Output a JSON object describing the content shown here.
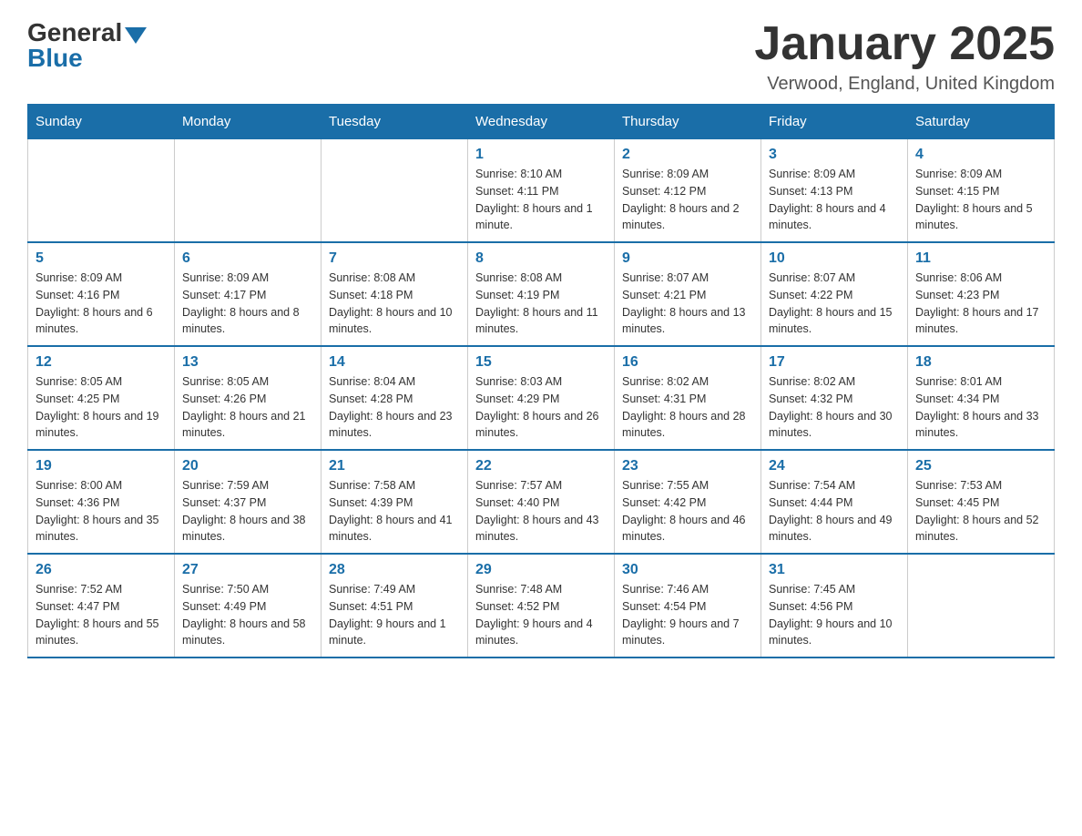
{
  "header": {
    "logo_general": "General",
    "logo_blue": "Blue",
    "title": "January 2025",
    "location": "Verwood, England, United Kingdom"
  },
  "days_of_week": [
    "Sunday",
    "Monday",
    "Tuesday",
    "Wednesday",
    "Thursday",
    "Friday",
    "Saturday"
  ],
  "weeks": [
    [
      {
        "day": "",
        "info": ""
      },
      {
        "day": "",
        "info": ""
      },
      {
        "day": "",
        "info": ""
      },
      {
        "day": "1",
        "info": "Sunrise: 8:10 AM\nSunset: 4:11 PM\nDaylight: 8 hours and 1 minute."
      },
      {
        "day": "2",
        "info": "Sunrise: 8:09 AM\nSunset: 4:12 PM\nDaylight: 8 hours and 2 minutes."
      },
      {
        "day": "3",
        "info": "Sunrise: 8:09 AM\nSunset: 4:13 PM\nDaylight: 8 hours and 4 minutes."
      },
      {
        "day": "4",
        "info": "Sunrise: 8:09 AM\nSunset: 4:15 PM\nDaylight: 8 hours and 5 minutes."
      }
    ],
    [
      {
        "day": "5",
        "info": "Sunrise: 8:09 AM\nSunset: 4:16 PM\nDaylight: 8 hours and 6 minutes."
      },
      {
        "day": "6",
        "info": "Sunrise: 8:09 AM\nSunset: 4:17 PM\nDaylight: 8 hours and 8 minutes."
      },
      {
        "day": "7",
        "info": "Sunrise: 8:08 AM\nSunset: 4:18 PM\nDaylight: 8 hours and 10 minutes."
      },
      {
        "day": "8",
        "info": "Sunrise: 8:08 AM\nSunset: 4:19 PM\nDaylight: 8 hours and 11 minutes."
      },
      {
        "day": "9",
        "info": "Sunrise: 8:07 AM\nSunset: 4:21 PM\nDaylight: 8 hours and 13 minutes."
      },
      {
        "day": "10",
        "info": "Sunrise: 8:07 AM\nSunset: 4:22 PM\nDaylight: 8 hours and 15 minutes."
      },
      {
        "day": "11",
        "info": "Sunrise: 8:06 AM\nSunset: 4:23 PM\nDaylight: 8 hours and 17 minutes."
      }
    ],
    [
      {
        "day": "12",
        "info": "Sunrise: 8:05 AM\nSunset: 4:25 PM\nDaylight: 8 hours and 19 minutes."
      },
      {
        "day": "13",
        "info": "Sunrise: 8:05 AM\nSunset: 4:26 PM\nDaylight: 8 hours and 21 minutes."
      },
      {
        "day": "14",
        "info": "Sunrise: 8:04 AM\nSunset: 4:28 PM\nDaylight: 8 hours and 23 minutes."
      },
      {
        "day": "15",
        "info": "Sunrise: 8:03 AM\nSunset: 4:29 PM\nDaylight: 8 hours and 26 minutes."
      },
      {
        "day": "16",
        "info": "Sunrise: 8:02 AM\nSunset: 4:31 PM\nDaylight: 8 hours and 28 minutes."
      },
      {
        "day": "17",
        "info": "Sunrise: 8:02 AM\nSunset: 4:32 PM\nDaylight: 8 hours and 30 minutes."
      },
      {
        "day": "18",
        "info": "Sunrise: 8:01 AM\nSunset: 4:34 PM\nDaylight: 8 hours and 33 minutes."
      }
    ],
    [
      {
        "day": "19",
        "info": "Sunrise: 8:00 AM\nSunset: 4:36 PM\nDaylight: 8 hours and 35 minutes."
      },
      {
        "day": "20",
        "info": "Sunrise: 7:59 AM\nSunset: 4:37 PM\nDaylight: 8 hours and 38 minutes."
      },
      {
        "day": "21",
        "info": "Sunrise: 7:58 AM\nSunset: 4:39 PM\nDaylight: 8 hours and 41 minutes."
      },
      {
        "day": "22",
        "info": "Sunrise: 7:57 AM\nSunset: 4:40 PM\nDaylight: 8 hours and 43 minutes."
      },
      {
        "day": "23",
        "info": "Sunrise: 7:55 AM\nSunset: 4:42 PM\nDaylight: 8 hours and 46 minutes."
      },
      {
        "day": "24",
        "info": "Sunrise: 7:54 AM\nSunset: 4:44 PM\nDaylight: 8 hours and 49 minutes."
      },
      {
        "day": "25",
        "info": "Sunrise: 7:53 AM\nSunset: 4:45 PM\nDaylight: 8 hours and 52 minutes."
      }
    ],
    [
      {
        "day": "26",
        "info": "Sunrise: 7:52 AM\nSunset: 4:47 PM\nDaylight: 8 hours and 55 minutes."
      },
      {
        "day": "27",
        "info": "Sunrise: 7:50 AM\nSunset: 4:49 PM\nDaylight: 8 hours and 58 minutes."
      },
      {
        "day": "28",
        "info": "Sunrise: 7:49 AM\nSunset: 4:51 PM\nDaylight: 9 hours and 1 minute."
      },
      {
        "day": "29",
        "info": "Sunrise: 7:48 AM\nSunset: 4:52 PM\nDaylight: 9 hours and 4 minutes."
      },
      {
        "day": "30",
        "info": "Sunrise: 7:46 AM\nSunset: 4:54 PM\nDaylight: 9 hours and 7 minutes."
      },
      {
        "day": "31",
        "info": "Sunrise: 7:45 AM\nSunset: 4:56 PM\nDaylight: 9 hours and 10 minutes."
      },
      {
        "day": "",
        "info": ""
      }
    ]
  ]
}
